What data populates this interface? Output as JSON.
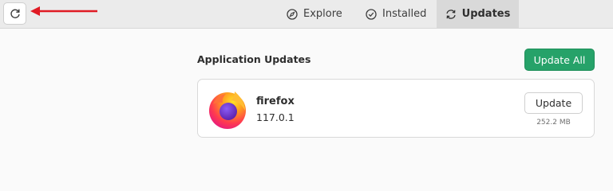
{
  "toolbar": {
    "refresh_icon": "refresh-icon",
    "annotation_color": "#e01b24"
  },
  "tabs": [
    {
      "label": "Explore",
      "icon": "compass-icon",
      "active": false
    },
    {
      "label": "Installed",
      "icon": "check-circle-icon",
      "active": false
    },
    {
      "label": "Updates",
      "icon": "sync-icon",
      "active": true
    }
  ],
  "main": {
    "section_title": "Application Updates",
    "update_all_label": "Update All",
    "accent_color": "#26a269"
  },
  "apps": [
    {
      "name": "firefox",
      "version": "117.0.1",
      "action_label": "Update",
      "size": "252.2 MB",
      "icon": "firefox-icon"
    }
  ]
}
